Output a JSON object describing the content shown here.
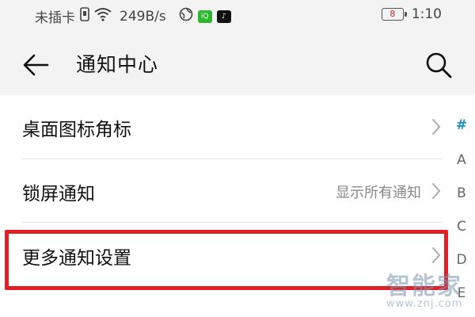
{
  "status_bar": {
    "carrier": "未插卡",
    "speed": "249B/s",
    "battery_level": "8",
    "time": "1:10",
    "icons": [
      "sim-card-icon",
      "wifi-icon",
      "vpn-globe-icon",
      "iqiyi-app-icon",
      "tiktok-app-icon",
      "battery-icon"
    ]
  },
  "header": {
    "title": "通知中心"
  },
  "list": {
    "items": [
      {
        "label": "桌面图标角标",
        "value": ""
      },
      {
        "label": "锁屏通知",
        "value": "显示所有通知"
      },
      {
        "label": "更多通知设置",
        "value": ""
      }
    ]
  },
  "index": {
    "letters": [
      "#",
      "A",
      "B",
      "C",
      "D",
      "E"
    ],
    "active": "#"
  },
  "watermark": {
    "logo": "智能家",
    "url": "www.znj.com"
  },
  "colors": {
    "highlight": "#e01f26",
    "index_active": "#1e90c9",
    "background": "#f3f3f3"
  }
}
